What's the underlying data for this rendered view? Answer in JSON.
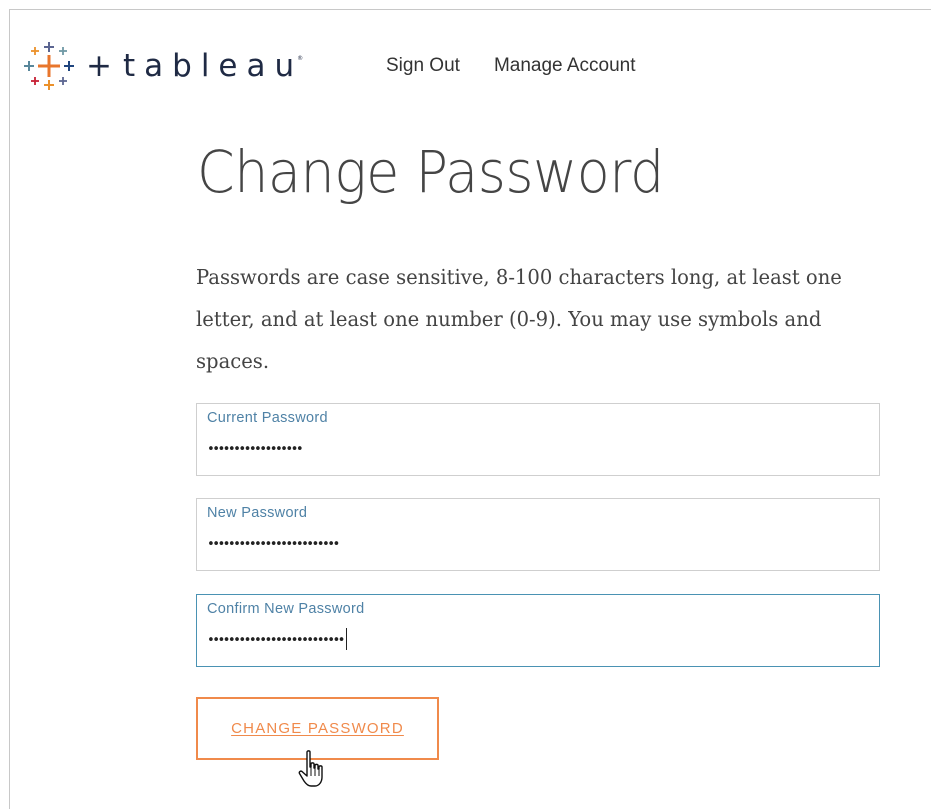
{
  "header": {
    "logo_text": "tableau",
    "logo_registered": "®",
    "nav": [
      {
        "label": "Sign Out"
      },
      {
        "label": "Manage Account"
      }
    ]
  },
  "main": {
    "title": "Change Password",
    "instructions": "Passwords are case sensitive, 8-100 characters long, at least one letter, and at least one number (0-9). You may use symbols and spaces.",
    "fields": [
      {
        "label": "Current Password",
        "value": "••••••••••••••••••",
        "focused": false
      },
      {
        "label": "New Password",
        "value": "•••••••••••••••••••••••••",
        "focused": false
      },
      {
        "label": "Confirm New Password",
        "value": "••••••••••••••••••••••••••",
        "focused": true
      }
    ],
    "submit_label": "CHANGE PASSWORD"
  },
  "colors": {
    "brand_navy": "#1f2a44",
    "accent_orange": "#f08a4b",
    "focus_blue": "#4a92b3",
    "label_blue": "#4f82a6"
  },
  "icons": {
    "logo": "tableau-cross-logo-icon",
    "pointer": "hand-pointer-cursor-icon"
  }
}
